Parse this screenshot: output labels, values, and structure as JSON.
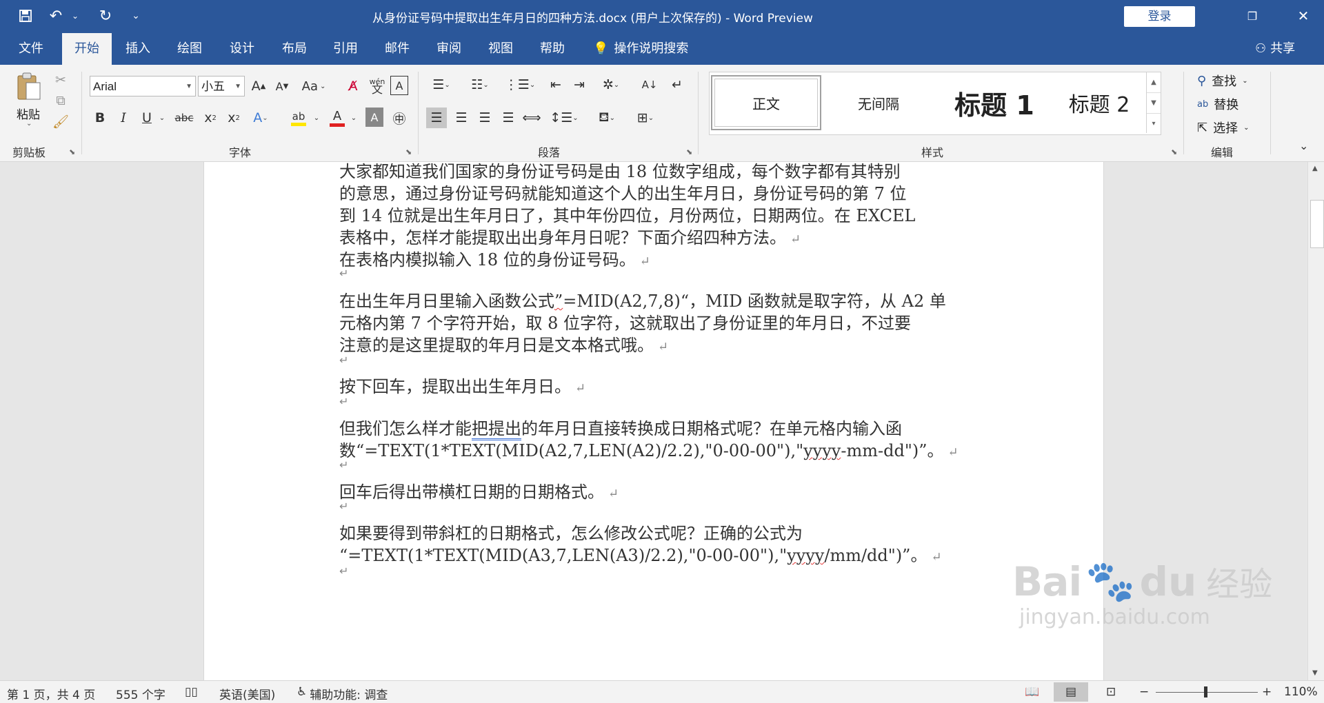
{
  "window": {
    "title": "从身份证号码中提取出生年月日的四种方法.docx (用户上次保存的)  -  Word Preview",
    "login_label": "登录"
  },
  "qat": {
    "save_icon": "save-icon",
    "undo_icon": "undo-icon",
    "redo_icon": "redo-icon",
    "customize_icon": "customize-qat-icon"
  },
  "tabs": [
    "文件",
    "开始",
    "插入",
    "绘图",
    "设计",
    "布局",
    "引用",
    "邮件",
    "审阅",
    "视图",
    "帮助"
  ],
  "active_tab": "开始",
  "tell_me": "操作说明搜索",
  "share": "共享",
  "clipboard": {
    "paste_label": "粘贴",
    "group_label": "剪贴板"
  },
  "font": {
    "name": "Arial",
    "size": "小五",
    "change_case": "Aa",
    "phonetic": "wén",
    "group_label": "字体"
  },
  "paragraph": {
    "group_label": "段落"
  },
  "styles": {
    "items": [
      "正文",
      "无间隔",
      "标题 1",
      "标题 2"
    ],
    "group_label": "样式"
  },
  "editing": {
    "find": "查找",
    "replace": "替换",
    "select": "选择",
    "group_label": "编辑"
  },
  "document": {
    "lines": [
      "大家都知道我们国家的身份证号码是由 18 位数字组成，每个数字都有其特别",
      "的意思，通过身份证号码就能知道这个人的出生年月日，身份证号码的第 7 位",
      "到 14 位就是出生年月日了，其中年份四位，月份两位，日期两位。在 EXCEL",
      "表格中，怎样才能提取出出身年月日呢？下面介绍四种方法。",
      "在表格内模拟输入 18 位的身份证号码。",
      "在出生年月日里输入函数公式",
      "”",
      "=MID(A2,7,8)“，MID 函数就是取字符，从 A2 单",
      "元格内第 7 个字符开始，取 8 位字符，这就取出了身份证里的年月日，不过要",
      "注意的是这里提取的年月日是文本格式哦。",
      "按下回车，提取出出生年月日。",
      "但我们怎么样才能",
      "把提出",
      "的年月日直接转换成日期格式呢？在单元格内输入函",
      "数“=TEXT(1*TEXT(MID(A2,7,LEN(A2)/2.2),\"0-00-00\"),\"",
      "yyyy",
      "-mm-dd\")”。",
      "回车后得出带横杠日期的日期格式。",
      "如果要得到带斜杠的日期格式，怎么修改公式呢？正确的公式为",
      "“=TEXT(1*TEXT(MID(A3,7,LEN(A3)/2.2),\"0-00-00\"),\"",
      "yyyy",
      "/mm/dd\")”。"
    ],
    "para_mark": "↵"
  },
  "status": {
    "page": "第 1 页，共 4 页",
    "words": "555 个字",
    "language": "英语(美国)",
    "accessibility": "辅助功能: 调查",
    "zoom": "110%"
  },
  "watermark": {
    "brand": "Bai",
    "brand2": "du",
    "cn": "经验",
    "url": "jingyan.baidu.com"
  }
}
